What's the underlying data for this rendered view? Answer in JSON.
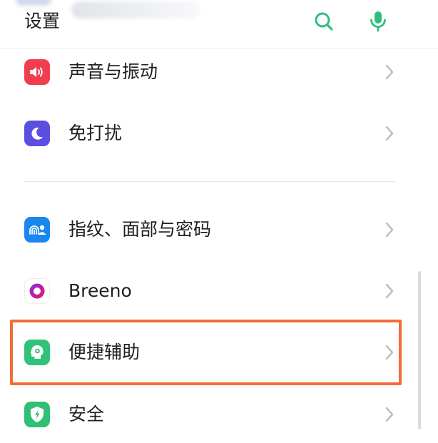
{
  "header": {
    "title": "设置",
    "search_icon": "search-icon",
    "mic_icon": "microphone-icon",
    "accent_color": "#2ebf7f"
  },
  "settings": {
    "items": [
      {
        "id": "sound",
        "label": "声音与振动",
        "icon": "speaker-icon",
        "icon_bg": "#ef3f4f"
      },
      {
        "id": "dnd",
        "label": "免打扰",
        "icon": "moon-icon",
        "icon_bg": "#5b4fe0"
      },
      {
        "id": "biometrics",
        "label": "指纹、面部与密码",
        "icon": "fingerprint-face-icon",
        "icon_bg": "#1a86f0"
      },
      {
        "id": "breeno",
        "label": "Breeno",
        "icon": "breeno-icon",
        "icon_bg": "#ffffff"
      },
      {
        "id": "accessibility",
        "label": "便捷辅助",
        "icon": "head-assist-icon",
        "icon_bg": "#2fc37a"
      },
      {
        "id": "security",
        "label": "安全",
        "icon": "shield-icon",
        "icon_bg": "#2fbf75"
      }
    ]
  },
  "highlight": {
    "target": "accessibility",
    "color": "#f26b3a"
  }
}
